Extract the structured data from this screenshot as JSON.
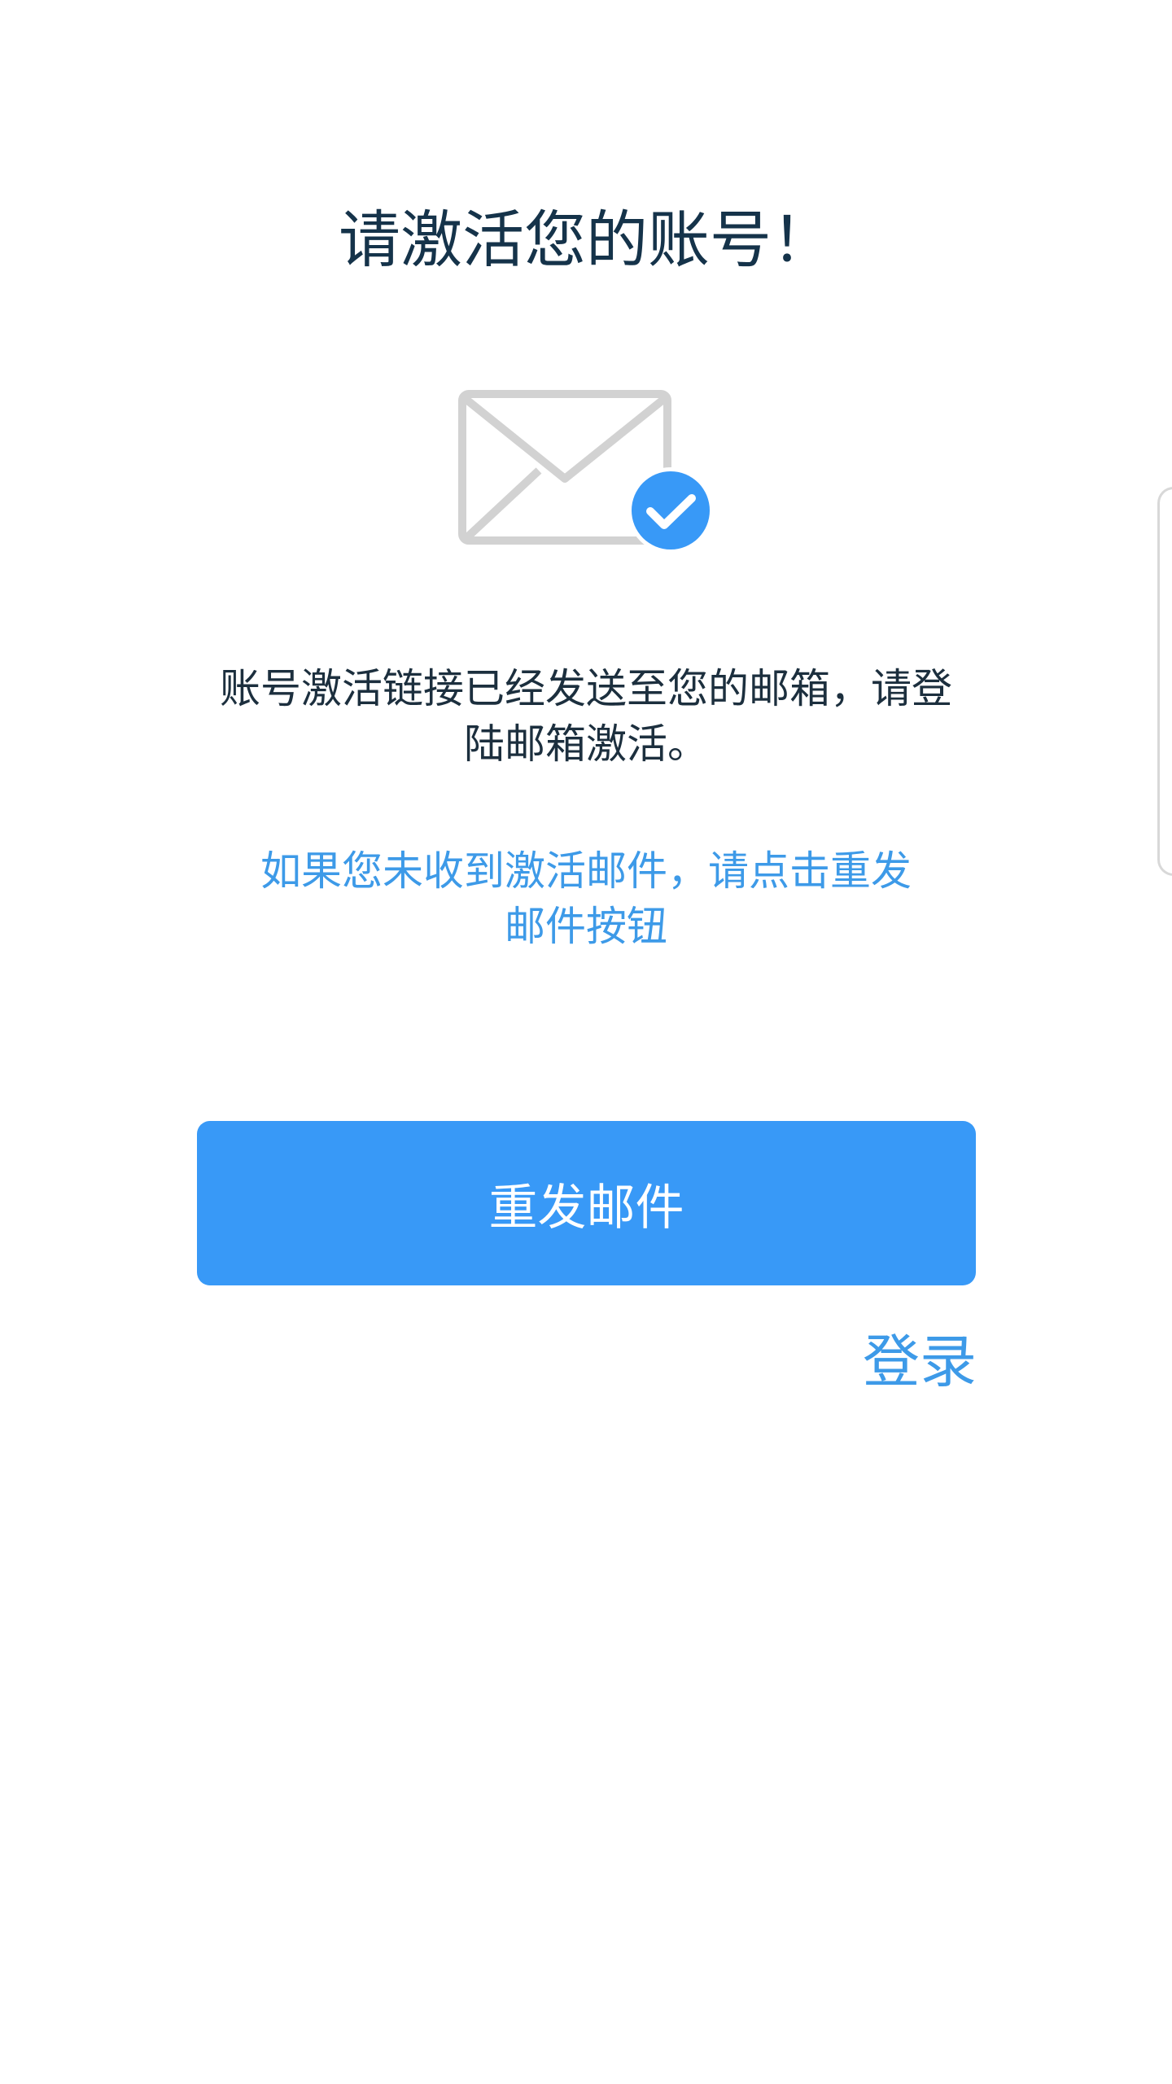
{
  "page": {
    "title": "请激活您的账号！",
    "info": "账号激活链接已经发送至您的邮箱，请登陆邮箱激活。",
    "hint": "如果您未收到激活邮件，请点击重发邮件按钮",
    "resend_button_label": "重发邮件",
    "login_link_label": "登录"
  },
  "icons": {
    "illustration": "mail-envelope-check-icon"
  },
  "colors": {
    "accent": "#3899f7",
    "link": "#3d9ae8",
    "title": "#15334a",
    "body_text": "#1c2f3e",
    "envelope": "#d2d2d2"
  }
}
